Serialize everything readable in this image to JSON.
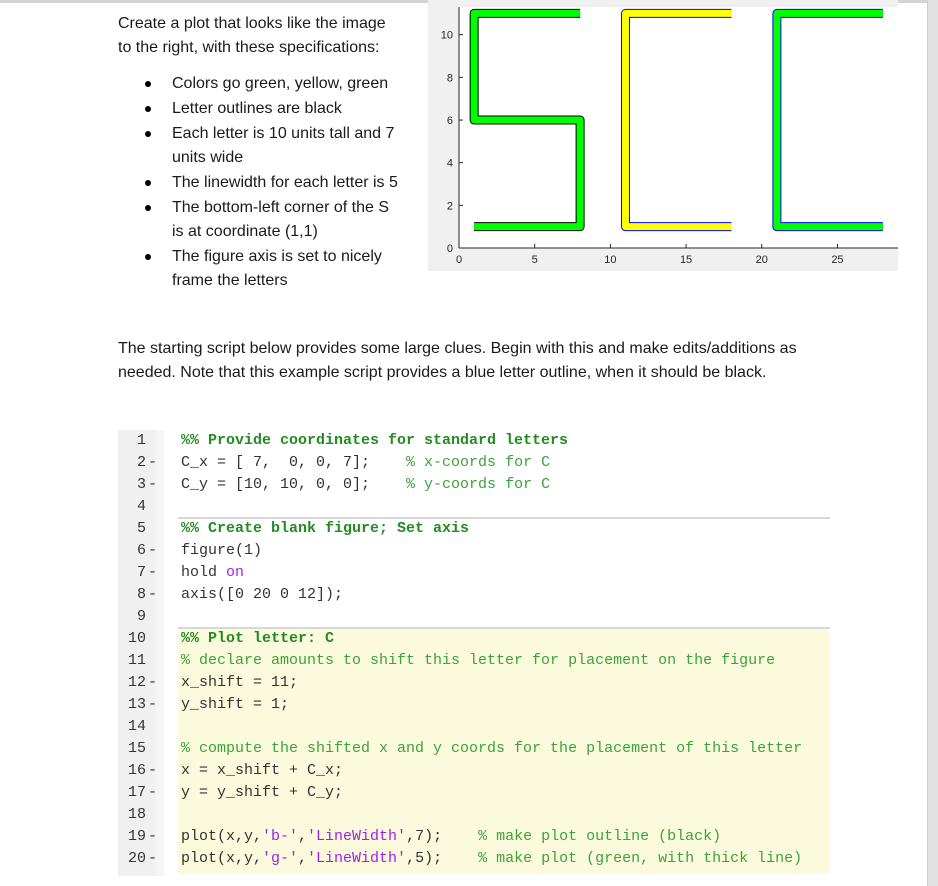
{
  "intro": {
    "line1": "Create a plot that looks like the image",
    "line2": "to the right, with these specifications:"
  },
  "bullets": [
    {
      "lines": [
        "Colors go green, yellow, green"
      ]
    },
    {
      "lines": [
        "Letter outlines are black"
      ]
    },
    {
      "lines": [
        "Each letter is 10 units tall and 7",
        "units wide"
      ]
    },
    {
      "lines": [
        "The linewidth for each letter is 5"
      ]
    },
    {
      "lines": [
        "The bottom-left corner of the S",
        "is at coordinate (1,1)"
      ]
    },
    {
      "lines": [
        "The figure axis is set to nicely",
        "frame the letters"
      ]
    }
  ],
  "paragraph": {
    "line1": "The starting script below provides some large clues. Begin with this and make edits/additions as",
    "line2": "needed. Note that this example script provides a blue letter outline, when it should be black."
  },
  "chart_data": {
    "type": "line",
    "title": "",
    "xlabel": "",
    "ylabel": "",
    "xlim": [
      0,
      29
    ],
    "ylim": [
      0,
      11.3
    ],
    "xticks": [
      0,
      5,
      10,
      15,
      20,
      25
    ],
    "yticks": [
      0,
      2,
      4,
      6,
      8,
      10
    ],
    "grid": false,
    "legend": "none",
    "series": [
      {
        "name": "S",
        "fill": "#00ff00",
        "outline": "#000000",
        "x": [
          8,
          1,
          1,
          8,
          8,
          1
        ],
        "y": [
          11,
          11,
          6,
          6,
          1,
          1
        ]
      },
      {
        "name": "C (yellow)",
        "fill": "#ffff00",
        "outline": "#0000ff",
        "x": [
          18,
          11,
          11,
          18
        ],
        "y": [
          11,
          11,
          1,
          1
        ]
      },
      {
        "name": "C (green)",
        "fill": "#00ff00",
        "outline": "#0000ff",
        "x": [
          28,
          21,
          21,
          28
        ],
        "y": [
          11,
          11,
          1,
          1
        ]
      }
    ]
  },
  "code": {
    "lines": [
      {
        "n": "1",
        "dash": "",
        "parts": [
          {
            "t": "%% Provide coordinates for standard letters",
            "c": "cellhead"
          }
        ]
      },
      {
        "n": "2",
        "dash": "-",
        "parts": [
          {
            "t": "C_x = [ 7,  0, 0, 7];    ",
            "c": ""
          },
          {
            "t": "% x-coords for C",
            "c": "cm"
          }
        ]
      },
      {
        "n": "3",
        "dash": "-",
        "parts": [
          {
            "t": "C_y = [10, 10, 0, 0];    ",
            "c": ""
          },
          {
            "t": "% y-coords for C",
            "c": "cm"
          }
        ]
      },
      {
        "n": "4",
        "dash": "",
        "parts": []
      },
      {
        "n": "5",
        "dash": "",
        "parts": [
          {
            "t": "%% Create blank figure; Set axis",
            "c": "cellhead"
          }
        ]
      },
      {
        "n": "6",
        "dash": "-",
        "parts": [
          {
            "t": "figure(1)",
            "c": ""
          }
        ]
      },
      {
        "n": "7",
        "dash": "-",
        "parts": [
          {
            "t": "hold ",
            "c": ""
          },
          {
            "t": "on",
            "c": "kw"
          }
        ]
      },
      {
        "n": "8",
        "dash": "-",
        "parts": [
          {
            "t": "axis([0 20 0 12]);",
            "c": ""
          }
        ]
      },
      {
        "n": "9",
        "dash": "",
        "parts": []
      },
      {
        "n": "10",
        "dash": "",
        "parts": [
          {
            "t": "%% Plot letter: C",
            "c": "cellhead"
          }
        ]
      },
      {
        "n": "11",
        "dash": "",
        "parts": [
          {
            "t": "% declare amounts to shift this letter for placement on the figure",
            "c": "cm"
          }
        ]
      },
      {
        "n": "12",
        "dash": "-",
        "parts": [
          {
            "t": "x_shift = 11;",
            "c": ""
          }
        ]
      },
      {
        "n": "13",
        "dash": "-",
        "parts": [
          {
            "t": "y_shift = 1;",
            "c": ""
          }
        ]
      },
      {
        "n": "14",
        "dash": "",
        "parts": []
      },
      {
        "n": "15",
        "dash": "",
        "parts": [
          {
            "t": "% compute the shifted x and y coords for the placement of this letter",
            "c": "cm"
          }
        ]
      },
      {
        "n": "16",
        "dash": "-",
        "parts": [
          {
            "t": "x = x_shift + C_x;",
            "c": ""
          }
        ]
      },
      {
        "n": "17",
        "dash": "-",
        "parts": [
          {
            "t": "y = y_shift + C_y;",
            "c": ""
          }
        ]
      },
      {
        "n": "18",
        "dash": "",
        "parts": []
      },
      {
        "n": "19",
        "dash": "-",
        "parts": [
          {
            "t": "plot(x,y,",
            "c": ""
          },
          {
            "t": "'b-'",
            "c": "str"
          },
          {
            "t": ",",
            "c": ""
          },
          {
            "t": "'LineWidth'",
            "c": "str"
          },
          {
            "t": ",7);    ",
            "c": ""
          },
          {
            "t": "% make plot outline (black)",
            "c": "cm"
          }
        ]
      },
      {
        "n": "20",
        "dash": "-",
        "parts": [
          {
            "t": "plot(x,y,",
            "c": ""
          },
          {
            "t": "'g-'",
            "c": "str"
          },
          {
            "t": ",",
            "c": ""
          },
          {
            "t": "'LineWidth'",
            "c": "str"
          },
          {
            "t": ",5);    ",
            "c": ""
          },
          {
            "t": "% make plot (green, with thick line)",
            "c": "cm"
          }
        ]
      }
    ]
  }
}
